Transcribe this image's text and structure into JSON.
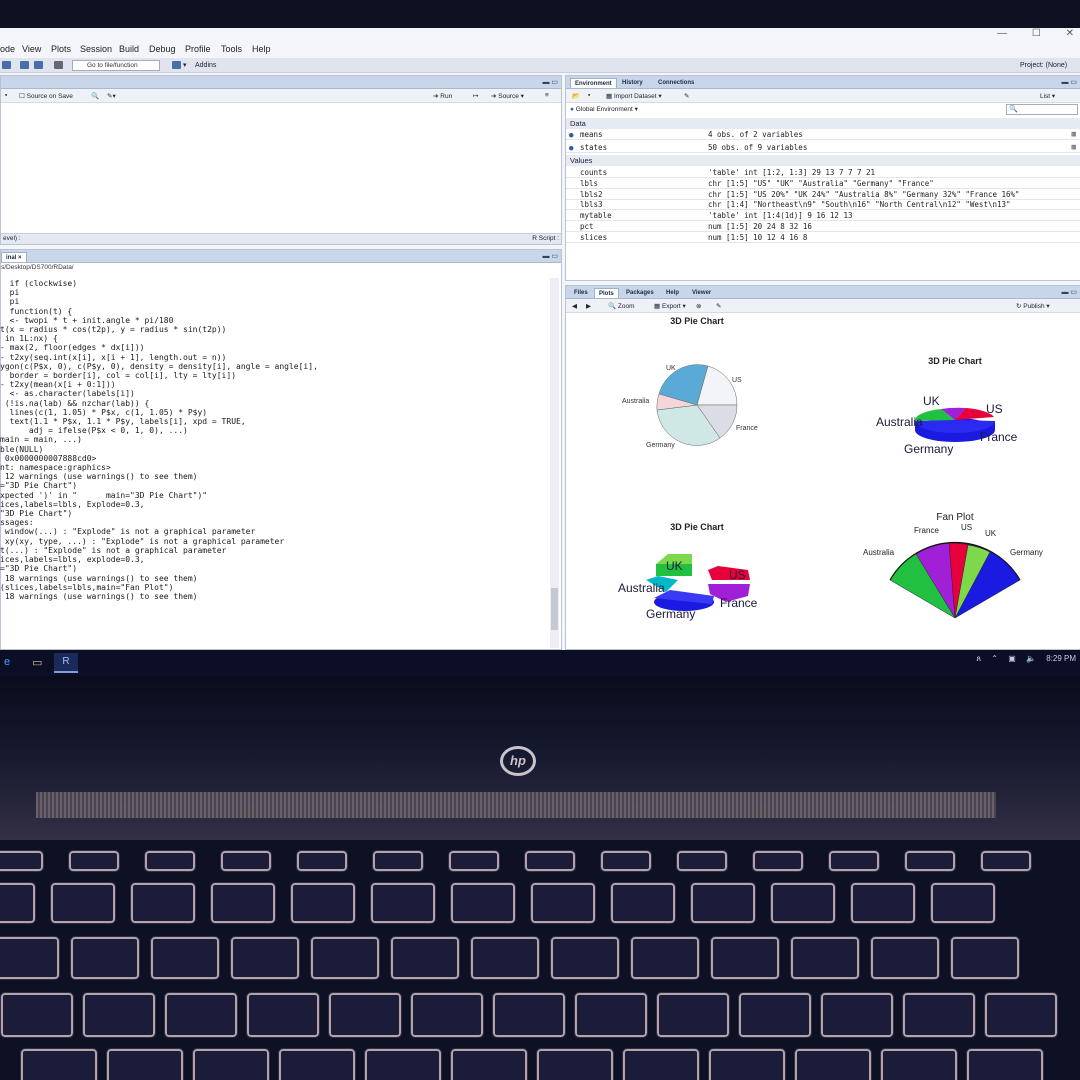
{
  "menubar": {
    "items": [
      "ode",
      "View",
      "Plots",
      "Session",
      "Build",
      "Debug",
      "Profile",
      "Tools",
      "Help"
    ]
  },
  "toolbar": {
    "goto_placeholder": "Go to file/function",
    "addins": "Addins",
    "project": "Project: (None)"
  },
  "source_pane": {
    "source_on_save": "Source on Save",
    "run": "Run",
    "source": "Source",
    "status_left": "evel) :",
    "status_right": "R Script :"
  },
  "console": {
    "tab": "inal ×",
    "path": "s/Desktop/DS700/RData/",
    "lines": [
      "  if (clockwise)",
      "  pi",
      "  pi",
      "  function(t) {",
      "  <- twopi * t + init.angle * pi/180",
      "t(x = radius * cos(t2p), y = radius * sin(t2p))",
      "",
      " in 1L:nx) {",
      "- max(2, floor(edges * dx[i]))",
      "- t2xy(seq.int(x[i], x[i + 1], length.out = n))",
      "ygon(c(P$x, 0), c(P$y, 0), density = density[i], angle = angle[i],",
      "  border = border[i], col = col[i], lty = lty[i])",
      "- t2xy(mean(x[i + 0:1]))",
      "  <- as.character(labels[i])",
      " (!is.na(lab) && nzchar(lab)) {",
      "  lines(c(1, 1.05) * P$x, c(1, 1.05) * P$y)",
      "  text(1.1 * P$x, 1.1 * P$y, labels[i], xpd = TRUE,",
      "      adj = ifelse(P$x < 0, 1, 0), ...)",
      "",
      "",
      "main = main, ...)",
      "ble(NULL)",
      "",
      " 0x0000000007888cd0>",
      "nt: namespace:graphics>",
      " 12 warnings (use warnings() to see them)",
      "=\"3D Pie Chart\")",
      "xpected ')' in \"      main=\"3D Pie Chart\")\"",
      "ices,labels=lbls, Explode=0.3,",
      "\"3D Pie Chart\")",
      "ssages:",
      " window(...) : \"Explode\" is not a graphical parameter",
      " xy(xy, type, ...) : \"Explode\" is not a graphical parameter",
      "t(...) : \"Explode\" is not a graphical parameter",
      "ices,labels=lbls, explode=0.3,",
      "=\"3D Pie Chart\")",
      " 18 warnings (use warnings() to see them)",
      "(slices,labels=lbls,main=\"Fan Plot\")",
      " 18 warnings (use warnings() to see them)"
    ]
  },
  "environment": {
    "tabs": [
      "Environment",
      "History",
      "Connections"
    ],
    "import_dataset": "Import Dataset",
    "list": "List",
    "scope": "Global Environment",
    "data_header": "Data",
    "values_header": "Values",
    "data_rows": [
      {
        "name": "means",
        "value": "4 obs. of 2 variables"
      },
      {
        "name": "states",
        "value": "50 obs. of 9 variables"
      }
    ],
    "value_rows": [
      {
        "name": "counts",
        "value": "'table' int [1:2, 1:3] 29 13 7 7 7 21"
      },
      {
        "name": "lbls",
        "value": "chr [1:5] \"US\" \"UK\" \"Australia\" \"Germany\" \"France\""
      },
      {
        "name": "lbls2",
        "value": "chr [1:5] \"US 20%\" \"UK 24%\" \"Australia 8%\" \"Germany 32%\" \"France 16%\""
      },
      {
        "name": "lbls3",
        "value": "chr [1:4] \"Northeast\\n9\" \"South\\n16\" \"North Central\\n12\" \"West\\n13\""
      },
      {
        "name": "mytable",
        "value": "'table' int [1:4(1d)] 9 16 12 13"
      },
      {
        "name": "pct",
        "value": "num [1:5] 20 24 8 32 16"
      },
      {
        "name": "slices",
        "value": "num [1:5] 10 12 4 16 8"
      }
    ]
  },
  "plots_pane": {
    "tabs": [
      "Files",
      "Plots",
      "Packages",
      "Help",
      "Viewer"
    ],
    "zoom": "Zoom",
    "export": "Export",
    "publish": "Publish",
    "chart1_title": "3D Pie Chart",
    "chart2_title": "3D Pie Chart",
    "chart3_title": "3D Pie Chart",
    "chart4_title": "Fan Plot",
    "labels": {
      "uk": "UK",
      "us": "US",
      "australia": "Australia",
      "germany": "Germany",
      "france": "France"
    }
  },
  "taskbar": {
    "time": "8:29 PM"
  },
  "colors": {
    "pie_uk": "#5aaad8",
    "pie_us": "#f2f4fa",
    "pie_australia": "#f4d6d8",
    "pie_germany": "#cfe8e6",
    "pie_france": "#dcdce6",
    "red": "#e8003c",
    "green": "#22c040",
    "blue": "#1a1ae0",
    "purple": "#a020d8",
    "cyan": "#00b8c8"
  }
}
